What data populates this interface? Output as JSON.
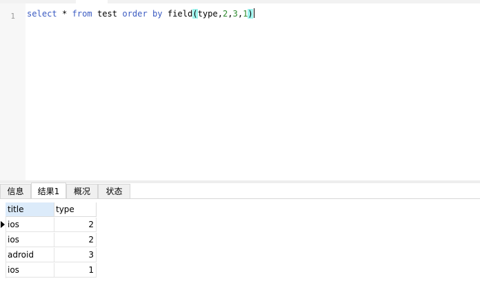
{
  "editor": {
    "line_number": "1",
    "query": {
      "select": "select",
      "star": "*",
      "from": "from",
      "table": "test",
      "order": "order",
      "by": "by",
      "func": "field",
      "open_paren": "(",
      "arg_col": "type",
      "comma1": ",",
      "arg1": "2",
      "comma2": ",",
      "arg2": "3",
      "comma3": ",",
      "arg3": "1",
      "close_paren": ")"
    }
  },
  "tabs": [
    {
      "label": "信息",
      "active": false
    },
    {
      "label": "结果1",
      "active": true
    },
    {
      "label": "概况",
      "active": false
    },
    {
      "label": "状态",
      "active": false
    }
  ],
  "grid": {
    "columns": [
      "title",
      "type"
    ],
    "rows": [
      [
        "ios",
        "2"
      ],
      [
        "ios",
        "2"
      ],
      [
        "adroid",
        "3"
      ],
      [
        "ios",
        "1"
      ]
    ],
    "current_row": 0
  },
  "colors": {
    "keyword": "#3b5bc2",
    "number": "#2e8a2e",
    "bracket_highlight": "#9ff5ef",
    "header_selected": "#dcebfa"
  }
}
